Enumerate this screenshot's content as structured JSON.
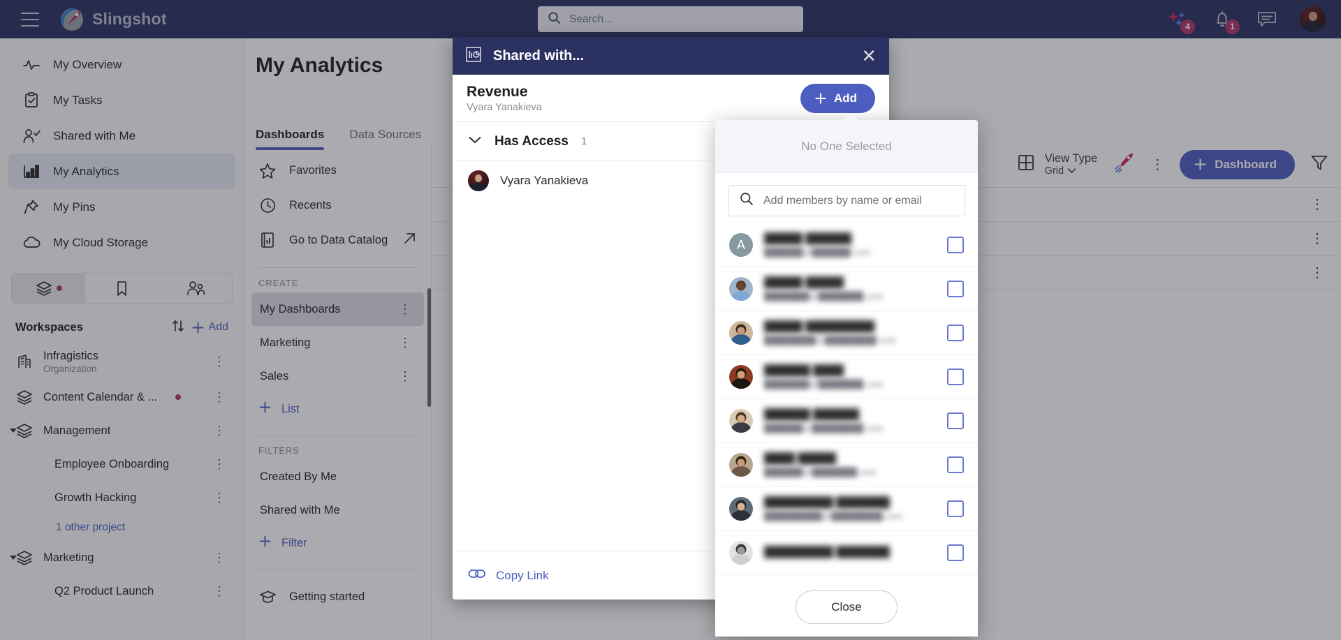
{
  "topbar": {
    "brand": "Slingshot",
    "search_placeholder": "Search...",
    "sparkle_badge": "4",
    "bell_badge": "1"
  },
  "sidebar": {
    "nav": [
      {
        "label": "My Overview",
        "icon": "pulse-icon",
        "active": false
      },
      {
        "label": "My Tasks",
        "icon": "clipboard-check-icon",
        "active": false
      },
      {
        "label": "Shared with Me",
        "icon": "person-check-icon",
        "active": false
      },
      {
        "label": "My Analytics",
        "icon": "bar-chart-icon",
        "active": true
      },
      {
        "label": "My Pins",
        "icon": "pin-icon",
        "active": false
      },
      {
        "label": "My Cloud Storage",
        "icon": "cloud-icon",
        "active": false
      }
    ],
    "segments": [
      {
        "name": "workspaces-tab",
        "icon": "layers-icon",
        "active": true,
        "dot": true
      },
      {
        "name": "bookmarks-tab",
        "icon": "bookmark-icon",
        "active": false,
        "dot": false
      },
      {
        "name": "people-tab",
        "icon": "people-icon",
        "active": false,
        "dot": false
      }
    ],
    "workspaces_title": "Workspaces",
    "sort_icon": "sort-arrows-icon",
    "add_label": "Add",
    "items": [
      {
        "label": "Infragistics",
        "sub": "Organization",
        "icon": "building-icon",
        "dot": false,
        "expandable": false
      },
      {
        "label": "Content Calendar & ...",
        "sub": "",
        "icon": "layers-icon",
        "dot": true,
        "expandable": false
      },
      {
        "label": "Management",
        "sub": "",
        "icon": "layers-icon",
        "dot": false,
        "expandable": true
      }
    ],
    "management_projects": [
      "Employee Onboarding",
      "Growth Hacking"
    ],
    "other_projects_label": "1 other project",
    "marketing": {
      "label": "Marketing",
      "icon": "layers-icon"
    },
    "marketing_projects": [
      "Q2 Product Launch"
    ]
  },
  "main": {
    "page_title": "My Analytics",
    "tabs": [
      {
        "label": "Dashboards",
        "active": true
      },
      {
        "label": "Data Sources",
        "active": false
      }
    ],
    "left_panel": {
      "quick": [
        {
          "label": "Favorites",
          "icon": "star-icon",
          "external": false
        },
        {
          "label": "Recents",
          "icon": "clock-icon",
          "external": false
        },
        {
          "label": "Go to Data Catalog",
          "icon": "catalog-icon",
          "external": true
        }
      ],
      "create_caption": "CREATE",
      "create_items": [
        {
          "label": "My Dashboards",
          "active": true
        },
        {
          "label": "Marketing",
          "active": false
        },
        {
          "label": "Sales",
          "active": false
        }
      ],
      "add_list_label": "List",
      "filters_caption": "FILTERS",
      "filter_items": [
        {
          "label": "Created By Me"
        },
        {
          "label": "Shared with Me"
        }
      ],
      "add_filter_label": "Filter",
      "getting_started_label": "Getting started"
    },
    "toolbar": {
      "view_type_label": "View Type",
      "view_type_value": "Grid",
      "grid_icon": "grid-icon",
      "rocket_icon": "rocket-icon",
      "more_icon": "kebab-menu-icon",
      "dashboard_button": "Dashboard",
      "filter_icon": "funnel-icon"
    },
    "row_count": 3
  },
  "share_modal": {
    "title": "Shared with...",
    "title_icon": "analytics-icon",
    "close_icon": "close-icon",
    "doc_name": "Revenue",
    "doc_owner": "Vyara Yanakieva",
    "add_button": "Add",
    "access_section_title": "Has Access",
    "access_count": "1",
    "chevron_icon": "chevron-down-icon",
    "members": [
      {
        "name": "Vyara Yanakieva"
      }
    ],
    "copy_link_label": "Copy Link",
    "copy_link_icon": "link-icon"
  },
  "member_picker": {
    "empty_label": "No One Selected",
    "search_placeholder": "Add members by name or email",
    "search_icon": "search-icon",
    "close_button": "Close",
    "rows": [
      {
        "avatar_kind": "initial",
        "initial": "A",
        "name": "█████ ██████",
        "email": "██████@██████.com",
        "checked": false
      },
      {
        "avatar_kind": "photo-a",
        "initial": "",
        "name": "█████ █████",
        "email": "███████@███████.com",
        "checked": false
      },
      {
        "avatar_kind": "photo-b",
        "initial": "",
        "name": "█████ █████████",
        "email": "████████@████████.com",
        "checked": false
      },
      {
        "avatar_kind": "photo-c",
        "initial": "",
        "name": "██████ ████",
        "email": "███████@███████.com",
        "checked": false
      },
      {
        "avatar_kind": "photo-d",
        "initial": "",
        "name": "██████ ██████",
        "email": "██████@████████.com",
        "checked": false
      },
      {
        "avatar_kind": "photo-e",
        "initial": "",
        "name": "████ █████",
        "email": "██████@███████.com",
        "checked": false
      },
      {
        "avatar_kind": "photo-f",
        "initial": "",
        "name": "█████████ ███████",
        "email": "█████████@████████.com",
        "checked": false
      },
      {
        "avatar_kind": "photo-g",
        "initial": "",
        "name": "█████████ ███████",
        "email": "",
        "checked": false
      }
    ]
  }
}
